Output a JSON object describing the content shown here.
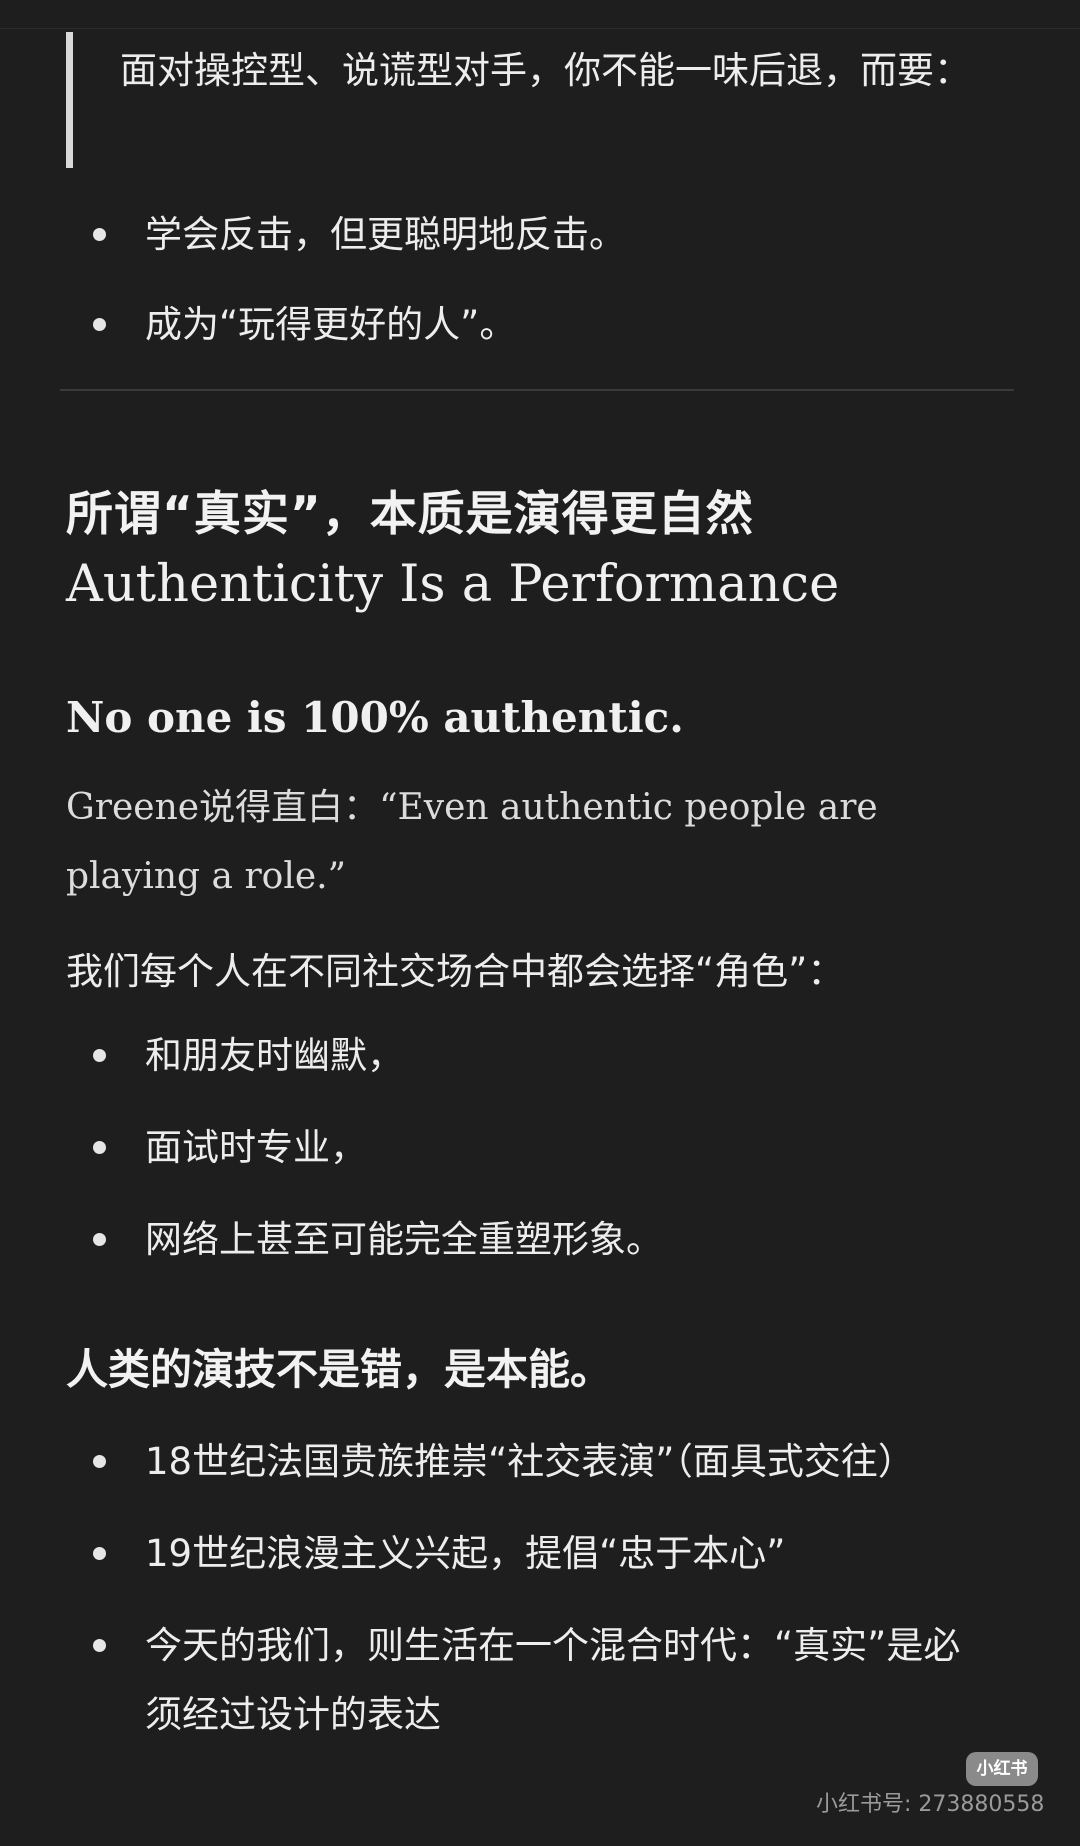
{
  "quote": {
    "text": "面对操控型、说谎型对手，你不能一味后退，而要："
  },
  "list1": [
    "学会反击，但更聪明地反击。",
    "成为“玩得更好的人”。"
  ],
  "section": {
    "title_cn": "所谓“真实”，本质是演得更自然",
    "title_en": "Authenticity Is a Performance",
    "subheading": "No one is 100% authentic.",
    "quote_para": "Greene说得直白：“Even authentic people are playing a role.”",
    "intro": "我们每个人在不同社交场合中都会选择“角色”："
  },
  "list2": [
    "和朋友时幽默，",
    "面试时专业，",
    "网络上甚至可能完全重塑形象。"
  ],
  "section2": {
    "heading": "人类的演技不是错，是本能。"
  },
  "list3": [
    "18世纪法国贵族推崇“社交表演”（面具式交往）",
    "19世纪浪漫主义兴起，提倡“忠于本心”",
    "今天的我们，则生活在一个混合时代：“真实”是必须经过设计的表达"
  ],
  "watermark": {
    "badge": "小红书",
    "id_text": "小红书号: 273880558"
  }
}
